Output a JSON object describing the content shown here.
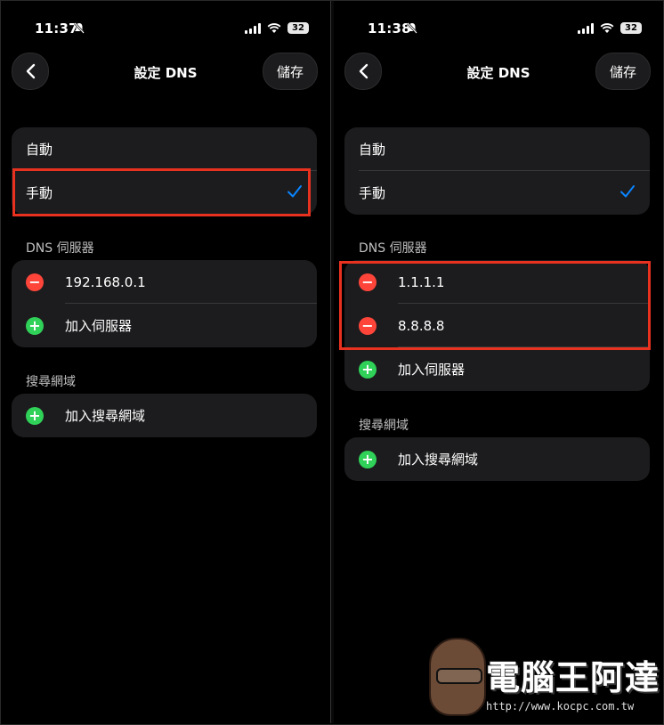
{
  "left": {
    "status": {
      "time": "11:37",
      "battery": "32"
    },
    "nav": {
      "title": "設定 DNS",
      "save_label": "儲存"
    },
    "mode_options": [
      {
        "label": "自動",
        "checked": false
      },
      {
        "label": "手動",
        "checked": true
      }
    ],
    "dns_section_title": "DNS 伺服器",
    "servers": [
      "192.168.0.1"
    ],
    "add_server_label": "加入伺服器",
    "search_section_title": "搜尋網域",
    "add_search_domain_label": "加入搜尋網域"
  },
  "right": {
    "status": {
      "time": "11:38",
      "battery": "32"
    },
    "nav": {
      "title": "設定 DNS",
      "save_label": "儲存"
    },
    "mode_options": [
      {
        "label": "自動",
        "checked": false
      },
      {
        "label": "手動",
        "checked": true
      }
    ],
    "dns_section_title": "DNS 伺服器",
    "servers": [
      "1.1.1.1",
      "8.8.8.8"
    ],
    "add_server_label": "加入伺服器",
    "search_section_title": "搜尋網域",
    "add_search_domain_label": "加入搜尋網域"
  },
  "watermark": {
    "text": "電腦王阿達",
    "url": "http://www.kocpc.com.tw"
  },
  "colors": {
    "highlight": "#e8321f",
    "checkmark": "#0a84ff",
    "remove": "#ff453a",
    "add": "#30d158"
  }
}
